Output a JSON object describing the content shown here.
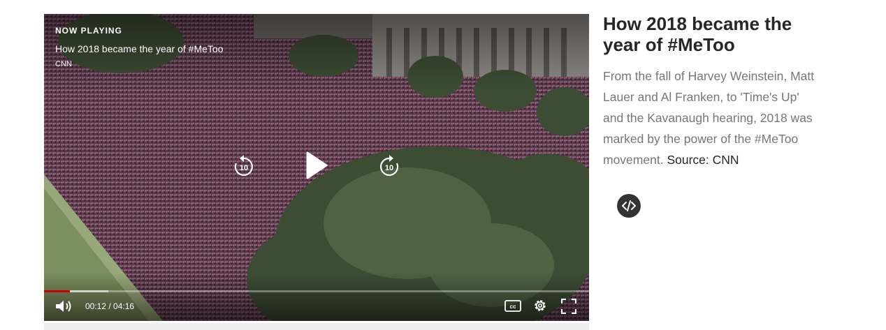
{
  "player": {
    "now_playing_label": "NOW PLAYING",
    "video_title": "How 2018 became the year of #MeToo",
    "source": "CNN",
    "current_time": "00:12",
    "duration": "04:16",
    "time_display": "00:12 / 04:16",
    "progress_fraction": 0.047,
    "buffered_fraction": 0.118,
    "skip_seconds": "10",
    "progress_color": "#cc0000",
    "icons": [
      "replay-10-icon",
      "play-icon",
      "forward-10-icon",
      "volume-icon",
      "closed-captions-icon",
      "settings-gear-icon",
      "fullscreen-icon"
    ]
  },
  "article": {
    "headline": "How 2018 became the year of #MeToo",
    "description": "From the fall of Harvey Weinstein, Matt Lauer and Al Franken, to 'Time's Up' and the Kavanaugh hearing, 2018 was marked by the power of the #MeToo movement.",
    "source_label": "Source: CNN",
    "embed_icon": "code-embed-icon"
  }
}
